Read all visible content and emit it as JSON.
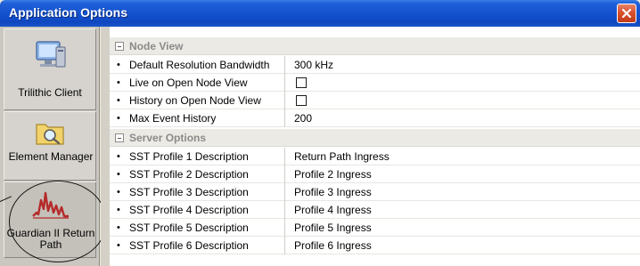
{
  "window": {
    "title": "Application Options"
  },
  "sidebar": {
    "items": [
      {
        "label": "Trilithic Client",
        "icon": "computer-icon"
      },
      {
        "label": "Element Manager",
        "icon": "folder-search-icon"
      },
      {
        "label": "Guardian II Return Path",
        "icon": "waveform-icon"
      }
    ]
  },
  "property_grid": {
    "categories": [
      {
        "title": "Node View",
        "rows": [
          {
            "name": "Default Resolution Bandwidth",
            "value": "300 kHz"
          },
          {
            "name": "Live on Open Node View",
            "checkbox": false
          },
          {
            "name": "History on Open Node View",
            "checkbox": false
          },
          {
            "name": "Max Event History",
            "value": "200"
          }
        ]
      },
      {
        "title": "Server Options",
        "rows": [
          {
            "name": "SST Profile 1 Description",
            "value": "Return Path Ingress"
          },
          {
            "name": "SST Profile 2 Description",
            "value": "Profile 2 Ingress"
          },
          {
            "name": "SST Profile 3 Description",
            "value": "Profile 3 Ingress"
          },
          {
            "name": "SST Profile 4 Description",
            "value": "Profile 4 Ingress"
          },
          {
            "name": "SST Profile 5 Description",
            "value": "Profile 5 Ingress"
          },
          {
            "name": "SST Profile 6 Description",
            "value": "Profile 6 Ingress"
          }
        ]
      }
    ]
  },
  "colors": {
    "titlebar": "#1452cf",
    "close_button": "#d9512d",
    "category_text": "#8b8b8b",
    "waveform": "#b52a2a"
  }
}
